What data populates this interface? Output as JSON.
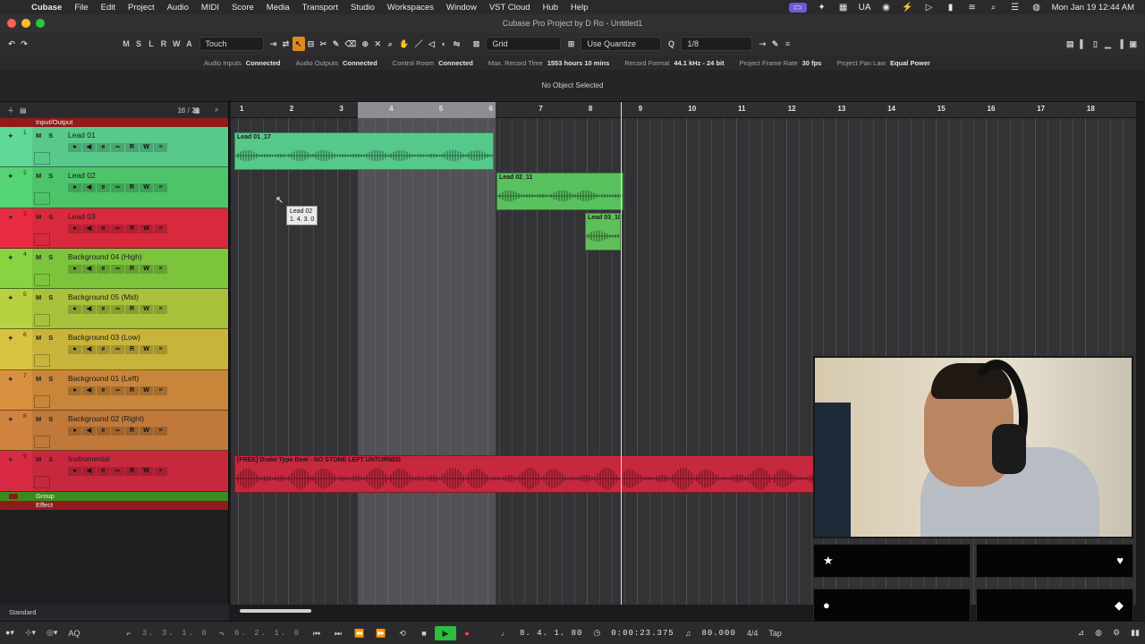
{
  "menubar": {
    "app": "Cubase",
    "items": [
      "File",
      "Edit",
      "Project",
      "Audio",
      "MIDI",
      "Score",
      "Media",
      "Transport",
      "Studio",
      "Workspaces",
      "Window",
      "VST Cloud",
      "Hub",
      "Help"
    ],
    "tray_locale": "UA",
    "clock": "Mon Jan 19  12:44 AM"
  },
  "window": {
    "title": "Cubase Pro Project by D Ro - Untitled1"
  },
  "toolbar": {
    "ms_buttons": [
      "M",
      "S",
      "L",
      "R",
      "W",
      "A"
    ],
    "automation_mode": "Touch",
    "snap_type": "Grid",
    "quantize_mode": "Use Quantize",
    "quantize_value": "1/8"
  },
  "status": [
    {
      "label": "Audio Inputs",
      "value": "Connected"
    },
    {
      "label": "Audio Outputs",
      "value": "Connected"
    },
    {
      "label": "Control Room",
      "value": "Connected"
    },
    {
      "label": "Max. Record Time",
      "value": "1553 hours 10 mins"
    },
    {
      "label": "Record Format",
      "value": "44.1 kHz - 24 bit"
    },
    {
      "label": "Project Frame Rate",
      "value": "30 fps"
    },
    {
      "label": "Project Pan Law",
      "value": "Equal Power"
    }
  ],
  "info_line": "No Object Selected",
  "tracklist": {
    "count": "16 / 21",
    "top_folder": "Input/Output",
    "tracks": [
      {
        "num": "1",
        "name": "Lead 01",
        "color": "#58c98a"
      },
      {
        "num": "2",
        "name": "Lead 02",
        "color": "#4ec46a"
      },
      {
        "num": "3",
        "name": "Lead 03",
        "color": "#d9293d"
      },
      {
        "num": "4",
        "name": "Background 04 (High)",
        "color": "#7cc43c"
      },
      {
        "num": "5",
        "name": "Background 05 (Mid)",
        "color": "#a9c23c"
      },
      {
        "num": "6",
        "name": "Background 03 (Low)",
        "color": "#c9b43b"
      },
      {
        "num": "7",
        "name": "Background 01 (Left)",
        "color": "#c9853a"
      },
      {
        "num": "8",
        "name": "Background 02 (Right)",
        "color": "#c0793a"
      },
      {
        "num": "9",
        "name": "Instrumental",
        "color": "#c8283e"
      }
    ],
    "bottom_folders": [
      "Group",
      "Effect"
    ],
    "ctrl_labels": [
      "●",
      "◀",
      "e",
      "∞",
      "R",
      "W",
      "≡"
    ],
    "ms": "MS"
  },
  "ruler": {
    "bars": [
      "1",
      "2",
      "3",
      "4",
      "5",
      "6",
      "7",
      "8",
      "9",
      "10",
      "11",
      "12",
      "13",
      "14",
      "15",
      "16",
      "17",
      "18"
    ]
  },
  "events": [
    {
      "name": "Lead 01_17",
      "color": "#56c98a"
    },
    {
      "name": "Lead 02_11",
      "color": "#58c25e"
    },
    {
      "name": "Lead 03_10",
      "color": "#5fc05a"
    },
    {
      "name": "[FREE] Drake Type Beat - NO STONE LEFT UNTURNED",
      "color": "#c6283e"
    }
  ],
  "tooltip": {
    "line1": "Lead 02",
    "line2": "1. 4. 3.  0"
  },
  "bottom": {
    "window_layout": "Standard"
  },
  "transport": {
    "left_locator": "3. 3. 1.   0",
    "right_locator": "6. 2. 1.   0",
    "primary_position": "8. 4. 1.  80",
    "secondary_position": "0:00:23.375",
    "tempo": "80.000",
    "signature": "4/4",
    "tap": "Tap",
    "aq": "AQ"
  }
}
